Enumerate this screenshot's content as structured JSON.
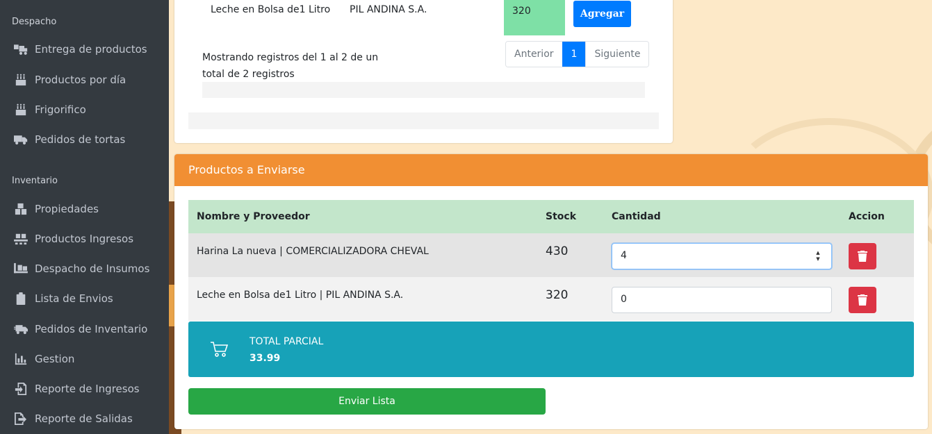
{
  "sidebar": {
    "section_despacho": "Despacho",
    "despacho_items": [
      {
        "label": "Entrega de productos",
        "icon": "truck-loading-icon"
      },
      {
        "label": "Productos por día",
        "icon": "birthday-cake-icon"
      },
      {
        "label": "Frigorifico",
        "icon": "birthday-cake-icon"
      },
      {
        "label": "Pedidos de tortas",
        "icon": "truck-icon"
      }
    ],
    "section_inventario": "Inventario",
    "inventario_items": [
      {
        "label": "Propiedades",
        "icon": "boxes-icon"
      },
      {
        "label": "Productos Ingresos",
        "icon": "pallet-icon"
      },
      {
        "label": "Despacho de Insumos",
        "icon": "dolly-icon"
      },
      {
        "label": "Lista de Envios",
        "icon": "clipboard-icon"
      },
      {
        "label": "Pedidos de Inventario",
        "icon": "shipping-fast-icon"
      },
      {
        "label": "Gestion",
        "icon": "chart-bar-icon"
      },
      {
        "label": "Reporte de Ingresos",
        "icon": "sign-in-icon"
      },
      {
        "label": "Reporte de Salidas",
        "icon": "sign-out-icon"
      }
    ]
  },
  "search_table": {
    "row": {
      "product": "Leche en Bolsa de1 Litro",
      "provider": "PIL ANDINA S.A.",
      "stock": "320"
    },
    "add_button": "Agregar",
    "info": "Mostrando registros del 1 al 2 de un total de 2 registros",
    "pager": {
      "prev": "Anterior",
      "page": "1",
      "next": "Siguiente"
    }
  },
  "send_card": {
    "title": "Productos a Enviarse",
    "headers": {
      "name": "Nombre y Proveedor",
      "stock": "Stock",
      "qty": "Cantidad",
      "action": "Accion"
    },
    "rows": [
      {
        "name": "Harina La nueva | COMERCIALIZADORA CHEVAL",
        "stock": "430",
        "qty": "4"
      },
      {
        "name": "Leche en Bolsa de1 Litro | PIL ANDINA S.A.",
        "stock": "320",
        "qty": "0"
      }
    ],
    "total_label": "TOTAL PARCIAL",
    "total_value": "33.99",
    "send_button": "Enviar Lista"
  },
  "colors": {
    "sidebar": "#343a40",
    "header": "#f18f33",
    "info": "#17a2b8",
    "success": "#28a745",
    "danger": "#dc3545",
    "primary": "#007bff"
  }
}
